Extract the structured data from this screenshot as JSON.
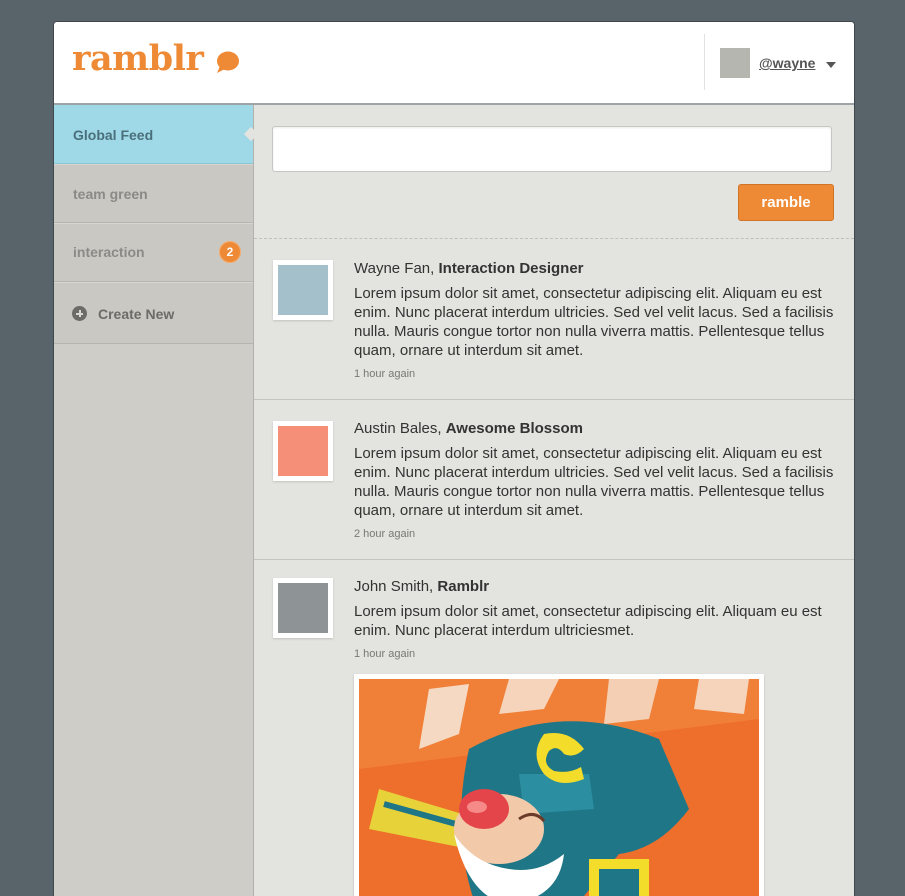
{
  "header": {
    "logo_text": "ramblr",
    "username": "@wayne",
    "brand_color": "#ee8a35"
  },
  "sidebar": {
    "items": [
      {
        "label": "Global Feed"
      },
      {
        "label": "team green"
      },
      {
        "label": "interaction",
        "badge": "2"
      },
      {
        "label": "Create New"
      }
    ]
  },
  "compose": {
    "placeholder": "",
    "button_label": "ramble"
  },
  "posts": [
    {
      "author": "Wayne Fan,",
      "role": "Interaction Designer",
      "body": "Lorem ipsum dolor sit amet, consectetur adipiscing elit. Aliquam eu est enim. Nunc placerat interdum ultricies. Sed vel velit lacus. Sed a facilisis nulla. Mauris congue tortor non nulla viverra mattis. Pellentesque tellus quam, ornare ut interdum sit amet.",
      "time": "1 hour again",
      "avatar_color": "#a4c0cb"
    },
    {
      "author": "Austin Bales,",
      "role": "Awesome Blossom",
      "body": "Lorem ipsum dolor sit amet, consectetur adipiscing elit. Aliquam eu est enim. Nunc placerat interdum ultricies. Sed vel velit lacus. Sed a facilisis nulla. Mauris congue tortor non nulla viverra mattis. Pellentesque tellus quam, ornare ut interdum sit amet.",
      "time": "2 hour again",
      "avatar_color": "#f58f78"
    },
    {
      "author": "John Smith,",
      "role": "Ramblr",
      "body": "Lorem ipsum dolor sit amet, consectetur adipiscing elit. Aliquam eu est enim. Nunc placerat interdum ultriciesmet.",
      "time": "1 hour again",
      "avatar_color": "#8e9396"
    }
  ]
}
